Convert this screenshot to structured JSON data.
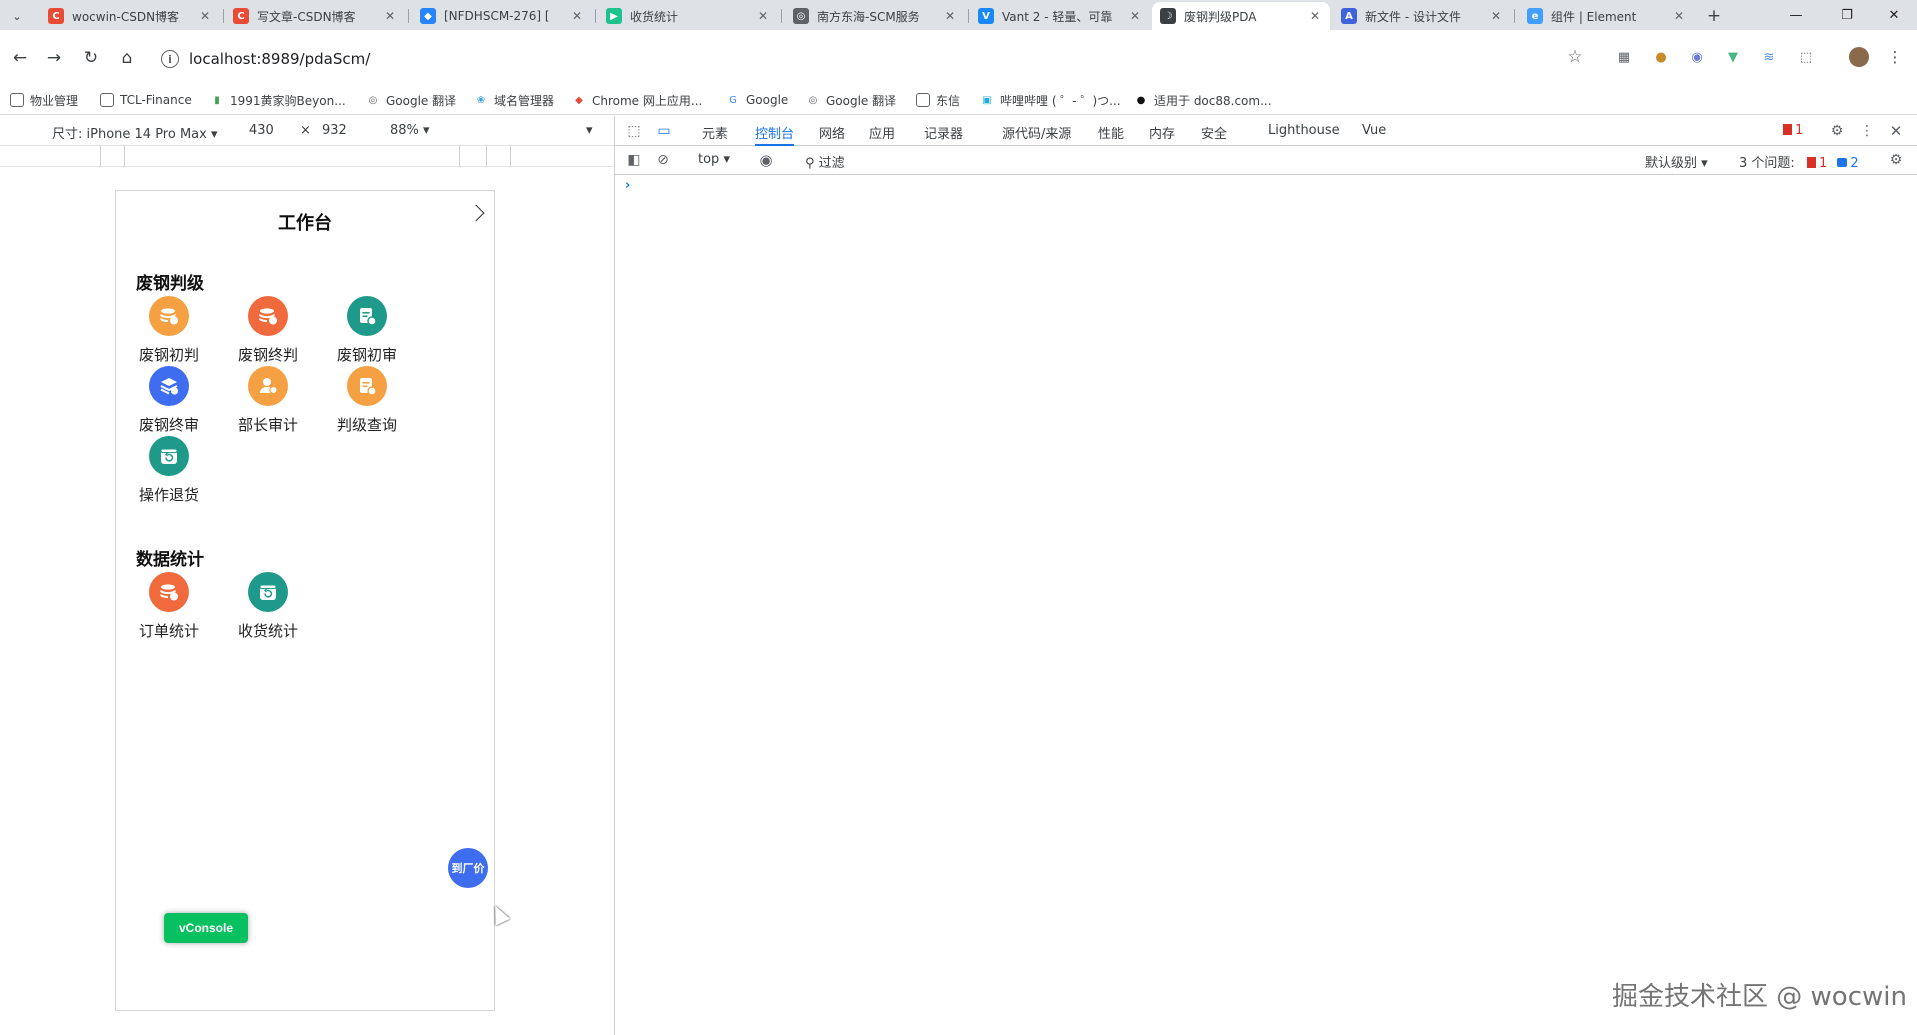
{
  "browser": {
    "tabs": [
      {
        "title": "wocwin-CSDN博客",
        "favicon": "csdn-icon",
        "color": "#e94b35",
        "letter": "C"
      },
      {
        "title": "写文章-CSDN博客",
        "favicon": "csdn-icon",
        "color": "#e94b35",
        "letter": "C"
      },
      {
        "title": "[NFDHSCM-276] [",
        "favicon": "jira-icon",
        "color": "#2684ff",
        "letter": "◆"
      },
      {
        "title": "收货统计",
        "favicon": "play-icon",
        "color": "#1ec28b",
        "letter": "▶"
      },
      {
        "title": "南方东海-SCM服务",
        "favicon": "globe-icon",
        "color": "#5f6368",
        "letter": "◎"
      },
      {
        "title": "Vant 2 - 轻量、可靠",
        "favicon": "vant-icon",
        "color": "#1989fa",
        "letter": "V"
      },
      {
        "title": "废钢判级PDA",
        "favicon": "moon-icon",
        "color": "#3c4043",
        "letter": "☽",
        "active": true
      },
      {
        "title": "新文件 - 设计文件",
        "favicon": "mastergo-icon",
        "color": "#3e63dd",
        "letter": "A"
      },
      {
        "title": "组件 | Element",
        "favicon": "element-icon",
        "color": "#409eff",
        "letter": "e"
      }
    ],
    "new_tab": "+",
    "window_controls": {
      "minimize": "—",
      "restore": "❐",
      "close": "✕"
    },
    "url": "localhost:8989/pdaScm/",
    "bookmarks": [
      {
        "label": "物业管理",
        "icon": "folder-icon"
      },
      {
        "label": "TCL-Finance",
        "icon": "folder-icon"
      },
      {
        "label": "1991黄家驹Beyon...",
        "icon": "video-icon"
      },
      {
        "label": "Google 翻译",
        "icon": "globe-icon"
      },
      {
        "label": "域名管理器",
        "icon": "swirl-icon"
      },
      {
        "label": "Chrome 网上应用...",
        "icon": "store-icon"
      },
      {
        "label": "Google",
        "icon": "google-icon"
      },
      {
        "label": "Google 翻译",
        "icon": "globe-icon"
      },
      {
        "label": "东信",
        "icon": "folder-icon"
      },
      {
        "label": "哔哩哔哩 ( ゜- ゜)つ...",
        "icon": "bilibili-icon"
      },
      {
        "label": "适用于 doc88.com...",
        "icon": "doc88-icon"
      }
    ]
  },
  "device_toolbar": {
    "size_label": "尺寸: iPhone 14 Pro Max",
    "width": "430",
    "times": "×",
    "height": "932",
    "zoom": "88%"
  },
  "devtools": {
    "tabs": [
      "元素",
      "控制台",
      "网络",
      "应用",
      "记录器",
      "源代码/来源",
      "性能",
      "内存",
      "安全",
      "Lighthouse",
      "Vue"
    ],
    "active_tab": "控制台",
    "error_count": "1",
    "context": "top",
    "filter_placeholder": "过滤",
    "level": "默认级别",
    "issues_label": "3 个问题:",
    "issues_errors": "1",
    "issues_info": "2",
    "prompt": "›"
  },
  "app": {
    "title": "工作台",
    "sections": [
      {
        "title": "废钢判级",
        "items": [
          {
            "label": "废钢初判",
            "icon": "coins-icon",
            "color": "#f5a143"
          },
          {
            "label": "废钢终判",
            "icon": "coins-icon",
            "color": "#f06a3e"
          },
          {
            "label": "废钢初审",
            "icon": "doc-check-icon",
            "color": "#1f9a8a"
          },
          {
            "label": "废钢终审",
            "icon": "stack-icon",
            "color": "#3e6df0"
          },
          {
            "label": "部长审计",
            "icon": "user-icon",
            "color": "#f5a143"
          },
          {
            "label": "判级查询",
            "icon": "doc-search-icon",
            "color": "#f5a143"
          },
          {
            "label": "操作退货",
            "icon": "return-box-icon",
            "color": "#1f9a8a"
          }
        ]
      },
      {
        "title": "数据统计",
        "items": [
          {
            "label": "订单统计",
            "icon": "coins-icon",
            "color": "#f06a3e"
          },
          {
            "label": "收货统计",
            "icon": "return-box-icon",
            "color": "#1f9a8a"
          }
        ]
      }
    ],
    "float_button": "到厂价",
    "vconsole": "vConsole"
  },
  "watermark": "掘金技术社区 @ wocwin"
}
